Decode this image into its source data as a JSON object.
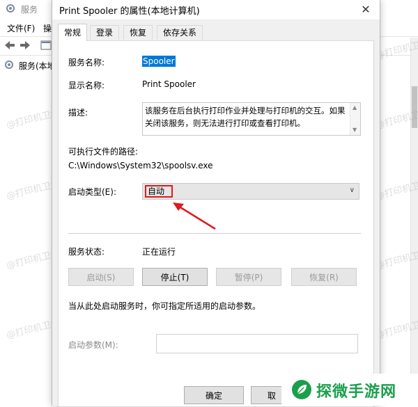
{
  "background": {
    "title": "服务",
    "menu": [
      "文件(F)",
      "操"
    ],
    "tree_label": "服务(本地"
  },
  "dialog": {
    "title": "Print Spooler 的属性(本地计算机)",
    "close_glyph": "✕",
    "tabs": [
      "常规",
      "登录",
      "恢复",
      "依存关系"
    ],
    "fields": {
      "service_name_label": "服务名称:",
      "service_name_value": "Spooler",
      "display_name_label": "显示名称:",
      "display_name_value": "Print Spooler",
      "description_label": "描述:",
      "description_value": "该服务在后台执行打印作业并处理与打印机的交互。如果关闭该服务，则无法进行打印或查看打印机。",
      "path_label": "可执行文件的路径:",
      "path_value": "C:\\Windows\\System32\\spoolsv.exe",
      "startup_type_label": "启动类型(E):",
      "startup_type_value": "自动",
      "status_label": "服务状态:",
      "status_value": "正在运行",
      "start_params_note": "当从此处启动服务时，你可指定所适用的启动参数。",
      "start_params_label": "启动参数(M):",
      "start_params_value": ""
    },
    "buttons": {
      "start": "启动(S)",
      "stop": "停止(T)",
      "pause": "暂停(P)",
      "resume": "恢复(R)",
      "ok": "确定",
      "cancel": "取"
    }
  },
  "watermark": "@打印机卫士",
  "brand": {
    "name": "探微手游网",
    "color": "#1aa04b"
  },
  "colors": {
    "selection": "#0078d7",
    "annotation": "#e0191f"
  }
}
